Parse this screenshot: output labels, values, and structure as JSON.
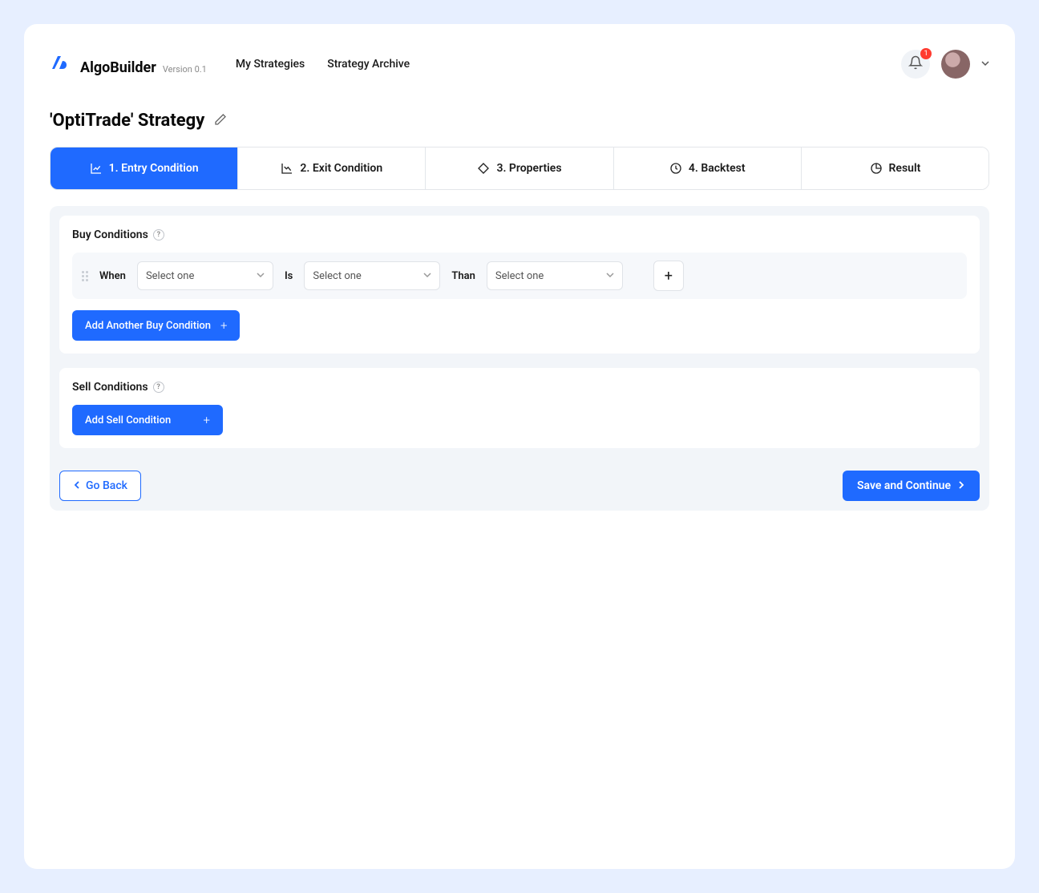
{
  "header": {
    "app_name": "AlgoBuilder",
    "version": "Version 0.1",
    "nav": {
      "my_strategies": "My Strategies",
      "strategy_archive": "Strategy Archive"
    },
    "notification_count": "1"
  },
  "page": {
    "title": "'OptiTrade' Strategy"
  },
  "tabs": {
    "entry": "1.  Entry Condition",
    "exit": "2.  Exit Condition",
    "properties": "3.  Properties",
    "backtest": "4.  Backtest",
    "result": "Result"
  },
  "buy": {
    "title": "Buy Conditions",
    "when_label": "When",
    "is_label": "Is",
    "than_label": "Than",
    "select_placeholder": "Select one",
    "add_another": "Add Another Buy Condition"
  },
  "sell": {
    "title": "Sell Conditions",
    "add": "Add Sell Condition"
  },
  "footer": {
    "go_back": "Go Back",
    "save_continue": "Save and Continue"
  }
}
